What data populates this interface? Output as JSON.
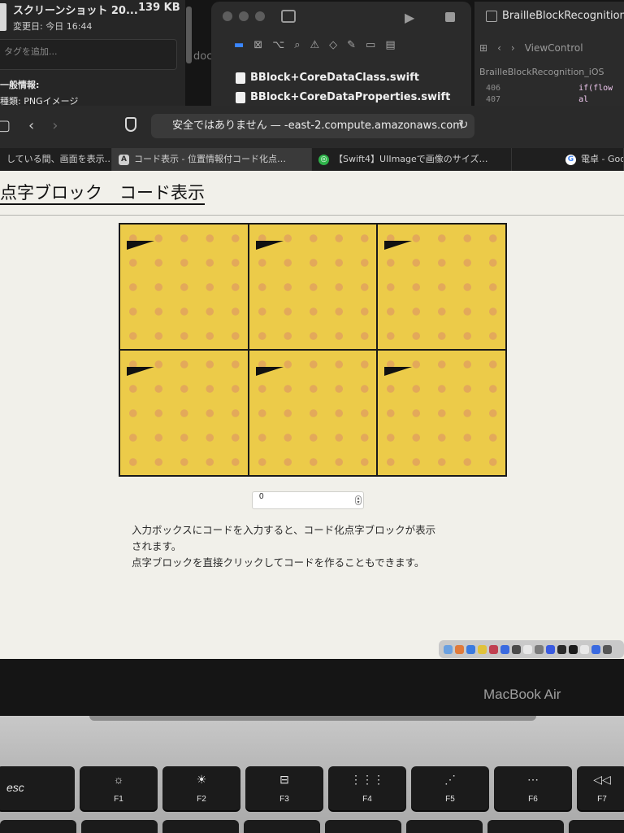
{
  "finder_info": {
    "file_name": "スクリーンショット 20...",
    "file_size": "139 KB",
    "modified": "変更日: 今日 16:44",
    "tags_placeholder": "タグを追加...",
    "general_section": "一般情報:",
    "kind": "種類: PNGイメージ"
  },
  "doc_fragment": "doc",
  "xcode": {
    "files": [
      "BBlock+CoreDataClass.swift",
      "BBlock+CoreDataProperties.swift"
    ]
  },
  "xcode_right": {
    "project": "BrailleBlockRecognition_iOS",
    "tab": "ViewControl",
    "crumb": "BrailleBlockRecognition_iOS",
    "lines": [
      "406",
      "407"
    ],
    "code_frag": "if(flow",
    "code_frag2": "al"
  },
  "browser": {
    "address": "安全ではありません — ",
    "address_host": "-east-2.compute.amazonaws.com",
    "tabs": [
      {
        "label": "している間、画面を表示…",
        "icon": ""
      },
      {
        "label": "コード表示 - 位置情報付コード化点…",
        "icon": "A"
      },
      {
        "label": "【Swift4】UIImageで画像のサイズ…",
        "icon": "◎"
      },
      {
        "label": "電卓 - Goo",
        "icon": "G"
      }
    ]
  },
  "page": {
    "title": "点字ブロック　コード表示",
    "code_input_value": "0",
    "description_lines": [
      "入力ボックスにコードを入力すると、コード化点字ブロックが表示",
      "されます。",
      "点字ブロックを直接クリックしてコードを作ることもできます。"
    ],
    "tile_count": 6,
    "colors": {
      "tile": "#eccb49",
      "dot": "#e3a95a",
      "marker": "#111111"
    }
  },
  "laptop": {
    "brand": "MacBook Air",
    "keys": [
      {
        "label": "esc",
        "symbol": ""
      },
      {
        "label": "F1",
        "symbol": "☼"
      },
      {
        "label": "F2",
        "symbol": "☀"
      },
      {
        "label": "F3",
        "symbol": "⊟"
      },
      {
        "label": "F4",
        "symbol": "⋮⋮⋮"
      },
      {
        "label": "F5",
        "symbol": "⋰"
      },
      {
        "label": "F6",
        "symbol": "⋯"
      },
      {
        "label": "F7",
        "symbol": "◁◁"
      }
    ]
  }
}
